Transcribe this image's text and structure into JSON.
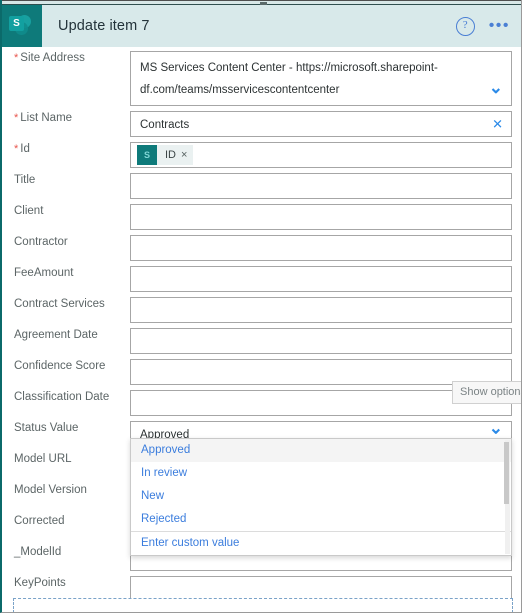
{
  "window": {
    "title": "Update item 7",
    "app_icon": "sharepoint-icon",
    "help_icon": "?",
    "overflow_icon": "•••"
  },
  "colors": {
    "header_bg": "#d8e9ea",
    "app_icon_bg": "#0e7a7a",
    "accent_blue": "#3b7ddd",
    "required_red": "#e8554d",
    "chevron_blue": "#2b8ae8"
  },
  "fields": [
    {
      "label": "Site Address",
      "required": true,
      "value": "MS Services Content Center - https://microsoft.sharepoint-df.com/teams/msservicescontentcenter",
      "icon": "chevron-down-icon",
      "tall": true
    },
    {
      "label": "List Name",
      "required": true,
      "value": "Contracts",
      "icon": "close-icon",
      "tall": false
    },
    {
      "label": "Id",
      "required": true,
      "value": "",
      "token": {
        "text": "ID",
        "remove": "×",
        "icon": "sharepoint-token-icon"
      },
      "icon": "",
      "tall": false
    },
    {
      "label": "Title",
      "required": false,
      "value": "",
      "icon": "",
      "tall": false
    },
    {
      "label": "Client",
      "required": false,
      "value": "",
      "icon": "",
      "tall": false
    },
    {
      "label": "Contractor",
      "required": false,
      "value": "",
      "icon": "",
      "tall": false
    },
    {
      "label": "FeeAmount",
      "required": false,
      "value": "",
      "icon": "",
      "tall": false
    },
    {
      "label": "Contract Services",
      "required": false,
      "value": "",
      "icon": "",
      "tall": false
    },
    {
      "label": "Agreement Date",
      "required": false,
      "value": "",
      "icon": "",
      "tall": false
    },
    {
      "label": "Confidence Score",
      "required": false,
      "value": "",
      "icon": "",
      "tall": false
    },
    {
      "label": "Classification Date",
      "required": false,
      "value": "",
      "icon": "",
      "tall": false
    },
    {
      "label": "Status Value",
      "required": false,
      "value": "Approved",
      "icon": "chevron-down-icon",
      "tall": false
    },
    {
      "label": "Model URL",
      "required": false,
      "value": "",
      "icon": "",
      "tall": false
    },
    {
      "label": "Model Version",
      "required": false,
      "value": "",
      "icon": "",
      "tall": false
    },
    {
      "label": "Corrected",
      "required": false,
      "value": "",
      "icon": "",
      "tall": false
    },
    {
      "label": "_ModelId",
      "required": false,
      "value": "",
      "icon": "",
      "tall": false
    },
    {
      "label": "KeyPoints",
      "required": false,
      "value": "",
      "icon": "",
      "tall": false
    }
  ],
  "tooltip": {
    "text": "Show options"
  },
  "dropdown": {
    "open": true,
    "selected": "Approved",
    "options": [
      "Approved",
      "In review",
      "New",
      "Rejected"
    ],
    "custom_option": "Enter custom value"
  }
}
